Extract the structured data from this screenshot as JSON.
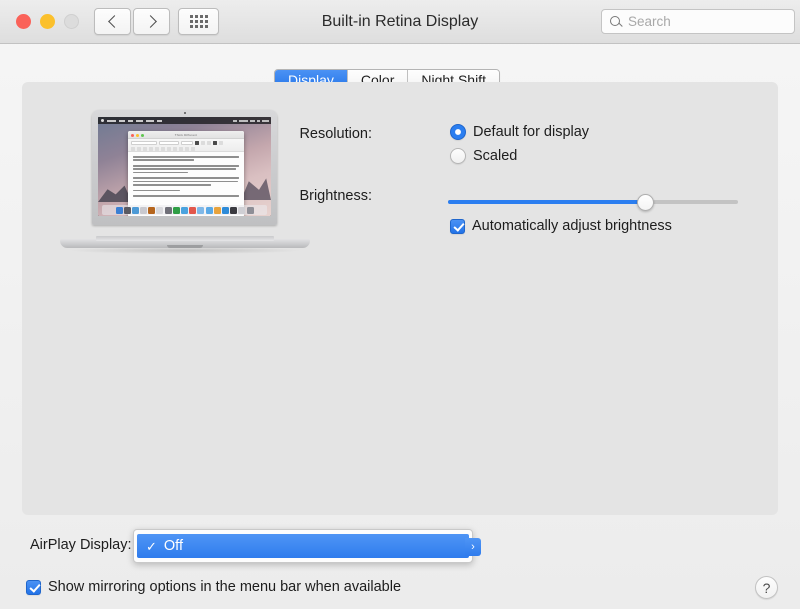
{
  "window": {
    "title": "Built-in Retina Display",
    "traffic_lights": [
      "close",
      "minimize",
      "zoom"
    ]
  },
  "toolbar": {
    "back_icon": "chevron-left-icon",
    "forward_icon": "chevron-right-icon",
    "show_all_icon": "grid-icon",
    "search": {
      "placeholder": "Search",
      "value": "",
      "icon": "search-icon"
    }
  },
  "tabs": [
    {
      "label": "Display",
      "active": true
    },
    {
      "label": "Color",
      "active": false
    },
    {
      "label": "Night Shift",
      "active": false
    }
  ],
  "display_panel": {
    "preview": {
      "device": "macbook-pro-retina",
      "document_title": "Think Different",
      "dock_icon_colors": [
        "#3b7fd4",
        "#5a5a62",
        "#4d9ad6",
        "#c9c9cf",
        "#b5651d",
        "#d8d8dc",
        "#6f6f78",
        "#2f9e46",
        "#4aa3df",
        "#e2574c",
        "#7fb8e8",
        "#5aa9e6",
        "#e8a33d",
        "#2e8bd8",
        "#3a3a40",
        "#cfcfd4",
        "#8e8e96"
      ]
    },
    "resolution": {
      "label": "Resolution:",
      "options": [
        {
          "label": "Default for display",
          "selected": true
        },
        {
          "label": "Scaled",
          "selected": false
        }
      ]
    },
    "brightness": {
      "label": "Brightness:",
      "value_percent": 68,
      "auto_adjust": {
        "label": "Automatically adjust brightness",
        "checked": true
      }
    }
  },
  "airplay": {
    "label": "AirPlay Display:",
    "menu_open": true,
    "selected_option": "Off",
    "checkmark": "✓",
    "arrow_icon": "chevron-right-icon"
  },
  "mirroring": {
    "label": "Show mirroring options in the menu bar when available",
    "checked": true
  },
  "help_button": {
    "label": "?",
    "icon": "help-icon"
  },
  "colors": {
    "accent_blue": "#2b7ef0",
    "tab_active_blue": "#2273e8",
    "window_bg": "#ececec",
    "panel_bg": "#e4e4e4",
    "traffic_close": "#fa6259",
    "traffic_min": "#fbc02c",
    "traffic_zoom_disabled": "#dcdcdc"
  }
}
